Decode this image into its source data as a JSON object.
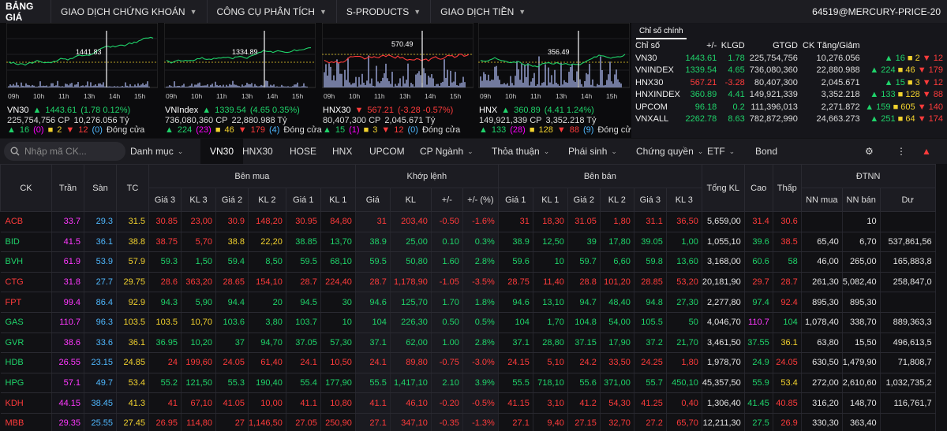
{
  "topnav": {
    "brand": "BẢNG GIÁ",
    "items": [
      "GIAO DỊCH CHỨNG KHOÁN",
      "CÔNG CỤ PHÂN TÍCH",
      "S-PRODUCTS",
      "GIAO DỊCH TIỀN"
    ],
    "user": "64519@MERCURY-PRICE-20"
  },
  "mini_charts": [
    {
      "name": "VN30",
      "price": "1443.61",
      "change": "(1.78  0.12%)",
      "vol": "225,754,756 CP",
      "val": "10,276.056 Tỷ",
      "up": "16",
      "ceil": "(0)",
      "flat": "2",
      "down": "12",
      "floor": "(0)",
      "status": "Đóng cửa",
      "label": "1441.83",
      "times": [
        "09h",
        "10h",
        "11h",
        "13h",
        "14h",
        "15h"
      ],
      "color": "up"
    },
    {
      "name": "VNIndex",
      "price": "1339.54",
      "change": "(4.65  0.35%)",
      "vol": "736,080,360 CP",
      "val": "22,880.988 Tỷ",
      "up": "224",
      "ceil": "(23)",
      "flat": "46",
      "down": "179",
      "floor": "(4)",
      "status": "Đóng cửa",
      "label": "1334.89",
      "times": [
        "09h",
        "10h",
        "11h",
        "13h",
        "14h",
        "15h"
      ],
      "color": "up"
    },
    {
      "name": "HNX30",
      "price": "567.21",
      "change": "(-3.28  -0.57%)",
      "vol": "80,407,300 CP",
      "val": "2,045.671 Tỷ",
      "up": "15",
      "ceil": "(1)",
      "flat": "3",
      "down": "12",
      "floor": "(0)",
      "status": "Đóng cửa",
      "label": "570.49",
      "times": [
        "09h",
        "10h",
        "11h",
        "13h",
        "14h",
        "15h"
      ],
      "color": "dn"
    },
    {
      "name": "HNX",
      "price": "360.89",
      "change": "(4.41  1.24%)",
      "vol": "149,921,339 CP",
      "val": "3,352.218 Tỷ",
      "up": "133",
      "ceil": "(28)",
      "flat": "128",
      "down": "88",
      "floor": "(9)",
      "status": "Đóng cửa",
      "label": "356.49",
      "times": [
        "09h",
        "10h",
        "11h",
        "13h",
        "14h",
        "15h"
      ],
      "color": "up"
    }
  ],
  "index_panel": {
    "title": "Chỉ số chính",
    "headers": [
      "Chỉ số",
      "+/-",
      "KLGD",
      "GTGD",
      "CK Tăng/Giảm"
    ],
    "rows": [
      {
        "name": "VN30",
        "value": "1443.61",
        "chg": "1.78",
        "klgd": "225,754,756",
        "gtgd": "10,276.056",
        "up": "16",
        "flat": "2",
        "down": "12",
        "c": "up"
      },
      {
        "name": "VNINDEX",
        "value": "1339.54",
        "chg": "4.65",
        "klgd": "736,080,360",
        "gtgd": "22,880.988",
        "up": "224",
        "flat": "46",
        "down": "179",
        "c": "up"
      },
      {
        "name": "HNX30",
        "value": "567.21",
        "chg": "-3.28",
        "klgd": "80,407,300",
        "gtgd": "2,045.671",
        "up": "15",
        "flat": "3",
        "down": "12",
        "c": "dn"
      },
      {
        "name": "HNXINDEX",
        "value": "360.89",
        "chg": "4.41",
        "klgd": "149,921,339",
        "gtgd": "3,352.218",
        "up": "133",
        "flat": "128",
        "down": "88",
        "c": "up"
      },
      {
        "name": "UPCOM",
        "value": "96.18",
        "chg": "0.2",
        "klgd": "111,396,013",
        "gtgd": "2,271.872",
        "up": "159",
        "flat": "605",
        "down": "140",
        "c": "up"
      },
      {
        "name": "VNXALL",
        "value": "2262.78",
        "chg": "8.63",
        "klgd": "782,872,990",
        "gtgd": "24,663.273",
        "up": "251",
        "flat": "64",
        "down": "174",
        "c": "up"
      }
    ]
  },
  "tabbar": {
    "search_placeholder": "Nhập mã CK...",
    "tabs": [
      "Danh mục",
      "VN30",
      "HNX30",
      "HOSE",
      "HNX",
      "UPCOM",
      "CP Ngành",
      "Thỏa thuận",
      "Phái sinh",
      "Chứng quyền",
      "ETF",
      "Bond"
    ]
  },
  "table": {
    "group_headers": [
      "Bên mua",
      "Khớp lệnh",
      "Bên bán",
      "ĐTNN"
    ],
    "headers": [
      "CK",
      "Trần",
      "Sàn",
      "TC",
      "Giá 3",
      "KL 3",
      "Giá 2",
      "KL 2",
      "Giá 1",
      "KL 1",
      "Giá",
      "KL",
      "+/-",
      "+/- (%)",
      "Giá 1",
      "KL 1",
      "Giá 2",
      "KL 2",
      "Giá 3",
      "KL 3",
      "Tổng KL",
      "Cao",
      "Thấp",
      "NN mua",
      "NN bán",
      "Dư"
    ],
    "rows": [
      {
        "c": [
          "ACB",
          "33.7",
          "29.3",
          "31.5",
          "30.85",
          "23,00",
          "30.9",
          "148,20",
          "30.95",
          "84,80",
          "31",
          "203,40",
          "-0.50",
          "-1.6%",
          "31",
          "18,30",
          "31.05",
          "1,80",
          "31.1",
          "36,50",
          "5,659,00",
          "31.4",
          "30.6",
          "",
          "10",
          ""
        ],
        "k": [
          "dn",
          "ce",
          "fl",
          "ref",
          "dn",
          "dn",
          "dn",
          "dn",
          "dn",
          "dn",
          "dn",
          "dn",
          "dn",
          "dn",
          "dn",
          "dn",
          "dn",
          "dn",
          "dn",
          "dn",
          "w",
          "dn",
          "dn",
          "w",
          "w",
          "w"
        ]
      },
      {
        "c": [
          "BID",
          "41.5",
          "36.1",
          "38.8",
          "38.75",
          "5,70",
          "38.8",
          "22,20",
          "38.85",
          "13,70",
          "38.9",
          "25,00",
          "0.10",
          "0.3%",
          "38.9",
          "12,50",
          "39",
          "17,80",
          "39.05",
          "1,00",
          "1,055,10",
          "39.6",
          "38.5",
          "65,40",
          "6,70",
          "537,861,56"
        ],
        "k": [
          "up",
          "ce",
          "fl",
          "ref",
          "dn",
          "dn",
          "ref",
          "ref",
          "up",
          "up",
          "up",
          "up",
          "up",
          "up",
          "up",
          "up",
          "up",
          "up",
          "up",
          "up",
          "w",
          "up",
          "dn",
          "w",
          "w",
          "w"
        ]
      },
      {
        "c": [
          "BVH",
          "61.9",
          "53.9",
          "57.9",
          "59.3",
          "1,50",
          "59.4",
          "8,50",
          "59.5",
          "68,10",
          "59.5",
          "50,80",
          "1.60",
          "2.8%",
          "59.6",
          "10",
          "59.7",
          "6,60",
          "59.8",
          "13,60",
          "3,168,00",
          "60.6",
          "58",
          "46,00",
          "265,00",
          "165,883,8"
        ],
        "k": [
          "up",
          "ce",
          "fl",
          "ref",
          "up",
          "up",
          "up",
          "up",
          "up",
          "up",
          "up",
          "up",
          "up",
          "up",
          "up",
          "up",
          "up",
          "up",
          "up",
          "up",
          "w",
          "up",
          "up",
          "w",
          "w",
          "w"
        ]
      },
      {
        "c": [
          "CTG",
          "31.8",
          "27.7",
          "29.75",
          "28.6",
          "363,20",
          "28.65",
          "154,10",
          "28.7",
          "224,40",
          "28.7",
          "1,178,90",
          "-1.05",
          "-3.5%",
          "28.75",
          "11,40",
          "28.8",
          "101,20",
          "28.85",
          "53,20",
          "20,181,90",
          "29.7",
          "28.7",
          "261,30",
          "5,082,40",
          "258,847,0"
        ],
        "k": [
          "dn",
          "ce",
          "fl",
          "ref",
          "dn",
          "dn",
          "dn",
          "dn",
          "dn",
          "dn",
          "dn",
          "dn",
          "dn",
          "dn",
          "dn",
          "dn",
          "dn",
          "dn",
          "dn",
          "dn",
          "w",
          "dn",
          "dn",
          "w",
          "w",
          "w"
        ]
      },
      {
        "c": [
          "FPT",
          "99.4",
          "86.4",
          "92.9",
          "94.3",
          "5,90",
          "94.4",
          "20",
          "94.5",
          "30",
          "94.6",
          "125,70",
          "1.70",
          "1.8%",
          "94.6",
          "13,10",
          "94.7",
          "48,40",
          "94.8",
          "27,30",
          "2,277,80",
          "97.4",
          "92.4",
          "895,30",
          "895,30",
          ""
        ],
        "k": [
          "dn",
          "ce",
          "fl",
          "ref",
          "up",
          "up",
          "up",
          "up",
          "up",
          "up",
          "up",
          "up",
          "up",
          "up",
          "up",
          "up",
          "up",
          "up",
          "up",
          "up",
          "w",
          "up",
          "dn",
          "w",
          "w",
          "w"
        ]
      },
      {
        "c": [
          "GAS",
          "110.7",
          "96.3",
          "103.5",
          "103.5",
          "10,70",
          "103.6",
          "3,80",
          "103.7",
          "10",
          "104",
          "226,30",
          "0.50",
          "0.5%",
          "104",
          "1,70",
          "104.8",
          "54,00",
          "105.5",
          "50",
          "4,046,70",
          "110.7",
          "104",
          "1,078,40",
          "338,70",
          "889,363,3"
        ],
        "k": [
          "up",
          "ce",
          "fl",
          "ref",
          "ref",
          "ref",
          "up",
          "up",
          "up",
          "up",
          "up",
          "up",
          "up",
          "up",
          "up",
          "up",
          "up",
          "up",
          "up",
          "up",
          "w",
          "ce",
          "up",
          "w",
          "w",
          "w"
        ]
      },
      {
        "c": [
          "GVR",
          "38.6",
          "33.6",
          "36.1",
          "36.95",
          "10,20",
          "37",
          "94,70",
          "37.05",
          "57,30",
          "37.1",
          "62,00",
          "1.00",
          "2.8%",
          "37.1",
          "28,80",
          "37.15",
          "17,90",
          "37.2",
          "21,70",
          "3,461,50",
          "37.55",
          "36.1",
          "63,80",
          "15,50",
          "496,613,5"
        ],
        "k": [
          "up",
          "ce",
          "fl",
          "ref",
          "up",
          "up",
          "up",
          "up",
          "up",
          "up",
          "up",
          "up",
          "up",
          "up",
          "up",
          "up",
          "up",
          "up",
          "up",
          "up",
          "w",
          "up",
          "ref",
          "w",
          "w",
          "w"
        ]
      },
      {
        "c": [
          "HDB",
          "26.55",
          "23.15",
          "24.85",
          "24",
          "199,60",
          "24.05",
          "61,40",
          "24.1",
          "10,50",
          "24.1",
          "89,80",
          "-0.75",
          "-3.0%",
          "24.15",
          "5,10",
          "24.2",
          "33,50",
          "24.25",
          "1,80",
          "1,978,70",
          "24.9",
          "24.05",
          "630,50",
          "1,479,90",
          "71,808,7"
        ],
        "k": [
          "up",
          "ce",
          "fl",
          "ref",
          "dn",
          "dn",
          "dn",
          "dn",
          "dn",
          "dn",
          "dn",
          "dn",
          "dn",
          "dn",
          "dn",
          "dn",
          "dn",
          "dn",
          "dn",
          "dn",
          "w",
          "up",
          "dn",
          "w",
          "w",
          "w"
        ]
      },
      {
        "c": [
          "HPG",
          "57.1",
          "49.7",
          "53.4",
          "55.2",
          "121,50",
          "55.3",
          "190,40",
          "55.4",
          "177,90",
          "55.5",
          "1,417,10",
          "2.10",
          "3.9%",
          "55.5",
          "718,10",
          "55.6",
          "371,00",
          "55.7",
          "450,10",
          "45,357,50",
          "55.9",
          "53.4",
          "272,00",
          "2,610,60",
          "1,032,735,2"
        ],
        "k": [
          "up",
          "ce",
          "fl",
          "ref",
          "up",
          "up",
          "up",
          "up",
          "up",
          "up",
          "up",
          "up",
          "up",
          "up",
          "up",
          "up",
          "up",
          "up",
          "up",
          "up",
          "w",
          "up",
          "ref",
          "w",
          "w",
          "w"
        ]
      },
      {
        "c": [
          "KDH",
          "44.15",
          "38.45",
          "41.3",
          "41",
          "67,10",
          "41.05",
          "10,00",
          "41.1",
          "10,80",
          "41.1",
          "46,10",
          "-0.20",
          "-0.5%",
          "41.15",
          "3,10",
          "41.2",
          "54,30",
          "41.25",
          "0,40",
          "1,306,40",
          "41.45",
          "40.85",
          "316,20",
          "148,70",
          "116,761,7"
        ],
        "k": [
          "dn",
          "ce",
          "fl",
          "ref",
          "dn",
          "dn",
          "dn",
          "dn",
          "dn",
          "dn",
          "dn",
          "dn",
          "dn",
          "dn",
          "dn",
          "dn",
          "dn",
          "dn",
          "dn",
          "dn",
          "w",
          "up",
          "dn",
          "w",
          "w",
          "w"
        ]
      },
      {
        "c": [
          "MBB",
          "29.35",
          "25.55",
          "27.45",
          "26.95",
          "114,80",
          "27",
          "1,146,50",
          "27.05",
          "250,90",
          "27.1",
          "347,10",
          "-0.35",
          "-1.3%",
          "27.1",
          "9,40",
          "27.15",
          "32,70",
          "27.2",
          "65,70",
          "12,211,30",
          "27.5",
          "26.9",
          "330,30",
          "363,40",
          ""
        ],
        "k": [
          "dn",
          "ce",
          "fl",
          "ref",
          "dn",
          "dn",
          "dn",
          "dn",
          "dn",
          "dn",
          "dn",
          "dn",
          "dn",
          "dn",
          "dn",
          "dn",
          "dn",
          "dn",
          "dn",
          "dn",
          "w",
          "up",
          "dn",
          "w",
          "w",
          "w"
        ]
      }
    ]
  }
}
